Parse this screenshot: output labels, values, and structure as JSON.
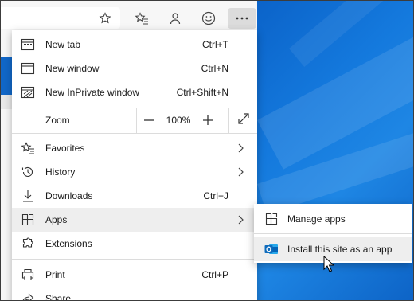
{
  "toolbar": {
    "icons": [
      "favorite-star-icon",
      "favorites-list-icon",
      "profile-icon",
      "feedback-smiley-icon",
      "more-dots-icon"
    ]
  },
  "menu": {
    "items": [
      {
        "name": "new-tab",
        "label": "New tab",
        "shortcut": "Ctrl+T",
        "icon": "new-tab-icon"
      },
      {
        "name": "new-window",
        "label": "New window",
        "shortcut": "Ctrl+N",
        "icon": "window-icon"
      },
      {
        "name": "new-inprivate-window",
        "label": "New InPrivate window",
        "shortcut": "Ctrl+Shift+N",
        "icon": "inprivate-icon"
      }
    ],
    "zoom": {
      "label": "Zoom",
      "decrease": "—",
      "value": "100%",
      "increase": "+",
      "fullscreen_icon": "expand-arrows-icon"
    },
    "items2": [
      {
        "name": "favorites",
        "label": "Favorites",
        "icon": "favorites-icon",
        "submenu": true
      },
      {
        "name": "history",
        "label": "History",
        "icon": "history-icon",
        "submenu": true
      },
      {
        "name": "downloads",
        "label": "Downloads",
        "shortcut": "Ctrl+J",
        "icon": "download-icon"
      },
      {
        "name": "apps",
        "label": "Apps",
        "icon": "apps-icon",
        "submenu": true,
        "highlighted": true
      },
      {
        "name": "extensions",
        "label": "Extensions",
        "icon": "puzzle-icon"
      }
    ],
    "items3": [
      {
        "name": "print",
        "label": "Print",
        "shortcut": "Ctrl+P",
        "icon": "printer-icon"
      },
      {
        "name": "share",
        "label": "Share",
        "icon": "share-icon"
      }
    ]
  },
  "apps_submenu": {
    "items": [
      {
        "label": "Manage apps",
        "icon": "apps-icon"
      },
      {
        "label": "Install this site as an app",
        "icon": "outlook-icon",
        "highlighted": true
      }
    ]
  },
  "colors": {
    "accent": "#1167c8",
    "desktop": "#1479dd",
    "hover": "#eeeeee",
    "outlook": "#0f6cbd"
  }
}
